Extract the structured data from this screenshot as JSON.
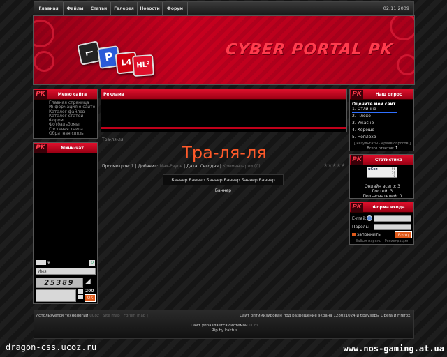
{
  "nav": {
    "items": [
      "Главная",
      "Файлы",
      "Статьи",
      "Галерея",
      "Новости",
      "Форум"
    ],
    "date": "02.11.2009"
  },
  "header": {
    "logo": "CYBER PORTAL PK",
    "tiles": [
      "P",
      "L4",
      "HL²"
    ]
  },
  "menu_block": {
    "title": "Меню сайта",
    "items": [
      "Главная страница",
      "Информация о сайте",
      "Каталог файлов",
      "Каталог статей",
      "Форум",
      "Фотоальбомы",
      "Гостевая книга",
      "Обратная связь"
    ]
  },
  "minichat": {
    "title": "Мини-чат",
    "name_placeholder": "Имя",
    "captcha": "25389",
    "counter": "200",
    "ok_label": "OK"
  },
  "ad_block": {
    "title": "Реклама"
  },
  "content": {
    "breadcrumb": "Тра-ля-ля",
    "title": "Тра-ля-ля",
    "meta_views": "Просмотров: 1",
    "meta_added_label": "Добавил:",
    "meta_author": "Max-Payne",
    "meta_date_label": "Дата:",
    "meta_date": "Сегодня",
    "meta_comments": "Комментарии (0)",
    "stars": "★★★★★",
    "banner_text": "Баннер Баннер Баннер Баннер Баннер Баннер Баннер"
  },
  "poll": {
    "title": "Наш опрос",
    "question": "Оцените мой сайт",
    "options": [
      "1. Отлично",
      "2. Плохо",
      "3. Ужасно",
      "4. Хорошо",
      "5. Неплохо"
    ],
    "links": "[ Результаты · Архив опросов ]",
    "total_label": "Всего ответов:",
    "total_value": "1"
  },
  "stats": {
    "title": "Статистика",
    "online_total": "Онлайн всего: 3",
    "guests": "Гостей: 3",
    "users": "Пользователей: 0",
    "counter_top": "uCoz",
    "counter_nums": [
      "56",
      "19",
      "0"
    ]
  },
  "login": {
    "title": "Форма входа",
    "email_label": "E-mail:",
    "password_label": "Пароль:",
    "remember_label": "запомнить",
    "login_button": "Вход",
    "forgot": "Забыл пароль",
    "register": "Регистрация"
  },
  "footer": {
    "tech": "Используется технологии",
    "tech_links": "uCoz | Site map | Forum map |",
    "optimized": "Сайт оптимизирован под разрешение экрана 1280x1024 и браузеры Opera и Firefox.",
    "powered": "Сайт управляется системой",
    "powered_link": "uCoz",
    "rip": "Rip by kaktus"
  },
  "watermarks": {
    "left": "dragon-css.ucoz.ru",
    "right": "www.nos-gaming.at.ua"
  }
}
